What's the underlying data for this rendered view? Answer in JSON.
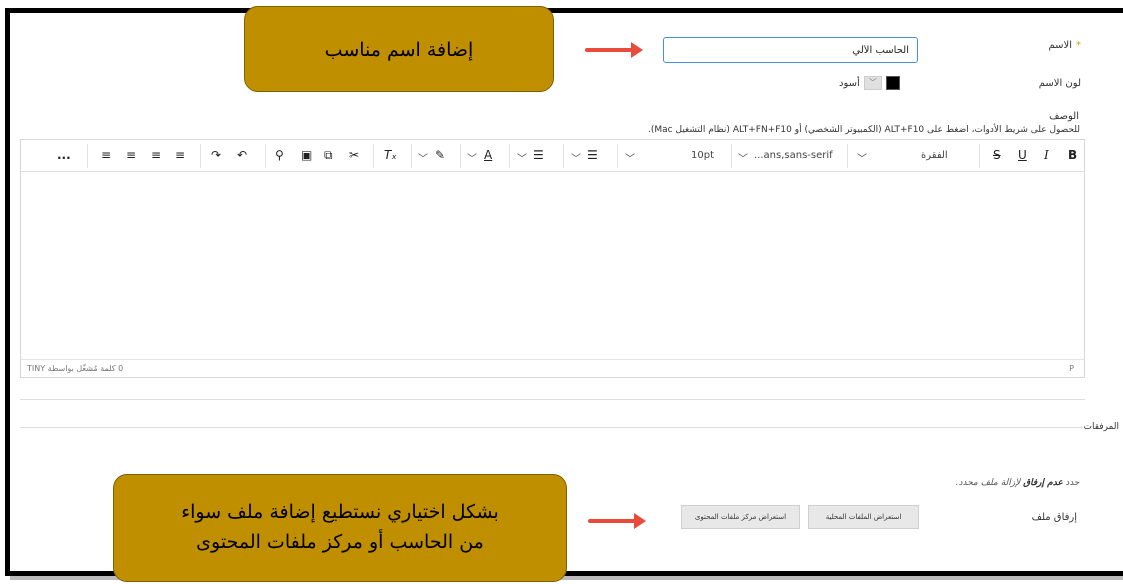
{
  "form": {
    "name_label": "الاسم",
    "required_mark": "*",
    "name_value": "الحاسب الألي",
    "name_color_label": "لون الاسم",
    "color_value": "أسود",
    "color_hex": "#000000",
    "description_label": "الوصف",
    "toolbar_hint": "للحصول على شريط الأدوات، اضغط على ALT+F10 (الكمبيوتر الشخصي) أو ALT+FN+F10 (نظام التشغيل Mac).",
    "attachments_label": "المرفقات",
    "no_attachment_prefix": "حدد",
    "no_attachment_bold": "عدم إرفاق",
    "no_attachment_suffix": "لإزالة ملف محدد.",
    "attach_file_label": "إرفاق ملف",
    "browse_local_label": "استعراض الملفات المحلية",
    "browse_content_label": "استعراض مركز ملفات المحتوى"
  },
  "editor": {
    "toolbar": {
      "bold": "B",
      "italic": "I",
      "underline": "U",
      "strike": "S",
      "paragraph": "الفقرة",
      "font": "...ans,sans-serif",
      "size": "10pt",
      "more": "..."
    },
    "status_words": "0 كلمة",
    "status_powered": "مُشغّل بواسطة TINY",
    "status_path": "P"
  },
  "callouts": {
    "name_tip": "إضافة اسم مناسب",
    "file_tip_line1": "بشكل اختياري نستطيع إضافة ملف سواء",
    "file_tip_line2": "من الحاسب أو مركز ملفات المحتوى",
    "color": "#bf8f00",
    "arrow_color": "#e84a3c"
  }
}
